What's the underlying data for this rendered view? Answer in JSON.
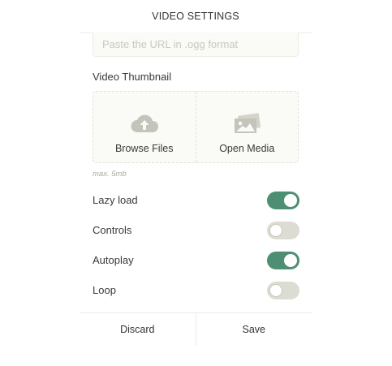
{
  "header": {
    "title": "VIDEO SETTINGS"
  },
  "url_field": {
    "placeholder": "Paste the URL in .ogg format",
    "value": ""
  },
  "thumbnail": {
    "label": "Video Thumbnail",
    "options": [
      {
        "label": "Browse Files",
        "icon": "cloud-upload-icon"
      },
      {
        "label": "Open Media",
        "icon": "image-gallery-icon"
      }
    ],
    "hint": "max. 5mb"
  },
  "toggles": [
    {
      "label": "Lazy load",
      "on": true
    },
    {
      "label": "Controls",
      "on": false
    },
    {
      "label": "Autoplay",
      "on": true
    },
    {
      "label": "Loop",
      "on": false
    }
  ],
  "footer": {
    "discard_label": "Discard",
    "save_label": "Save"
  },
  "colors": {
    "toggle_on": "#4e8f73",
    "toggle_off": "#dcdcd2",
    "icon": "#c4c4ba"
  }
}
